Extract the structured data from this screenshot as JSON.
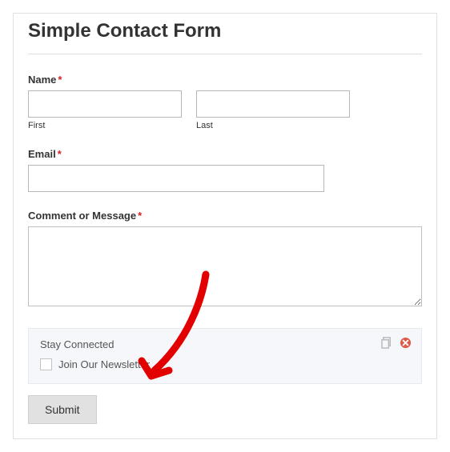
{
  "title": "Simple Contact Form",
  "fields": {
    "name": {
      "label": "Name",
      "first_sub": "First",
      "last_sub": "Last"
    },
    "email": {
      "label": "Email"
    },
    "comment": {
      "label": "Comment or Message"
    }
  },
  "required_marker": "*",
  "panel": {
    "title": "Stay Connected",
    "checkbox_label": "Join Our Newsletter"
  },
  "submit_label": "Submit"
}
